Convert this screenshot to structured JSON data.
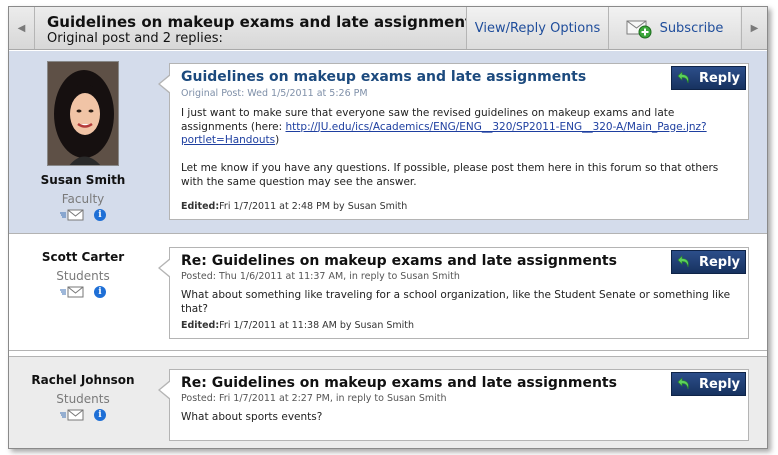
{
  "header": {
    "title": "Guidelines on makeup exams and late assignments",
    "subtitle": "Original post and 2 replies:",
    "view_reply_options": "View/Reply Options",
    "subscribe": "Subscribe"
  },
  "posts": [
    {
      "author": "Susan Smith",
      "role": "Faculty",
      "title": "Guidelines on makeup exams and late assignments",
      "meta": "Original Post: Wed 1/5/2011 at 5:26 PM",
      "body_1": "I just want to make sure that everyone saw the revised guidelines on makeup exams and late assignments (here: ",
      "link": "http://JU.edu/ics/Academics/ENG/ENG__320/SP2011-ENG__320-A/Main_Page.jnz?portlet=Handouts",
      "body_1_end": ")",
      "body_2": "Let me know if you have any questions. If possible, please post them here in this forum so that others with the same question may see the answer.",
      "edited_label": "Edited:",
      "edited_value": "Fri 1/7/2011 at 2:48 PM by Susan Smith",
      "reply": "Reply"
    },
    {
      "author": "Scott Carter",
      "role": "Students",
      "title": "Re: Guidelines on makeup exams and late assignments",
      "meta": "Posted: Thu 1/6/2011 at 11:37 AM, in reply to Susan Smith",
      "body_1": "What about something like traveling for a school organization, like the Student Senate or something like that?",
      "edited_label": "Edited:",
      "edited_value": "Fri 1/7/2011 at 11:38 AM by Susan Smith",
      "reply": "Reply"
    },
    {
      "author": "Rachel Johnson",
      "role": "Students",
      "title": "Re: Guidelines on makeup exams and late assignments",
      "meta": "Posted: Fri 1/7/2011 at 2:27 PM, in reply to Susan Smith",
      "body_1": "What about sports events?",
      "reply": "Reply"
    }
  ],
  "colors": {
    "accent": "#1c4a7e",
    "reply_button": "#1f3f74",
    "highlight_row": "#d4dceb"
  },
  "icons": [
    "chevron-left-icon",
    "chevron-right-icon",
    "subscribe-icon",
    "mail-icon",
    "info-icon",
    "reply-arrow-icon"
  ]
}
